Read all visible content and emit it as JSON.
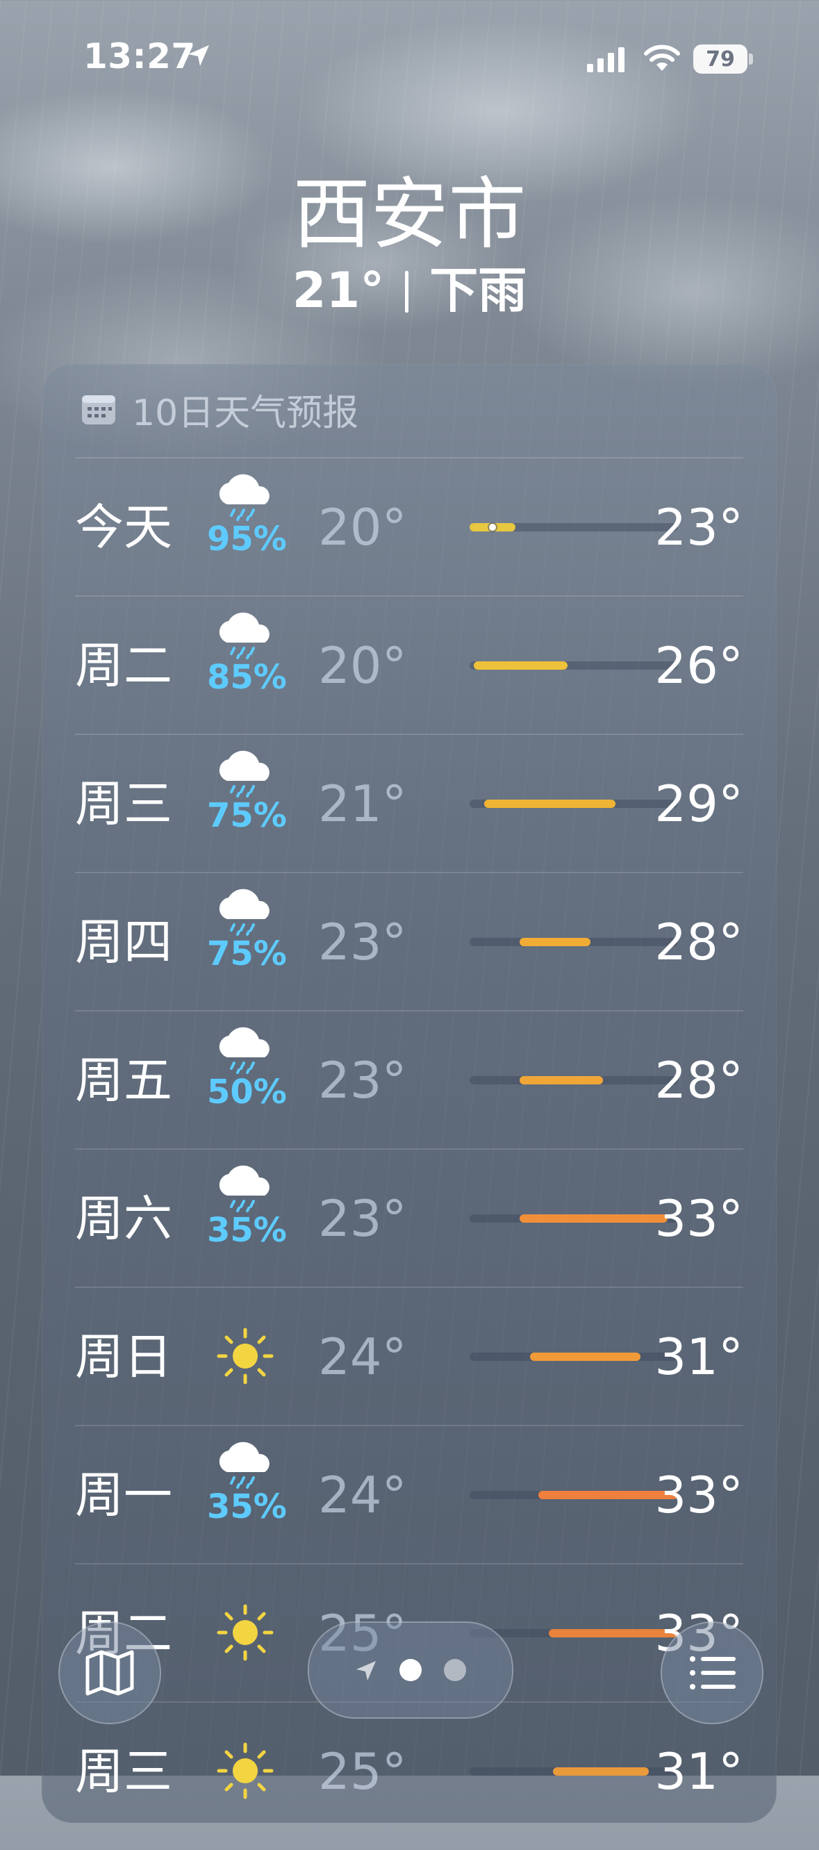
{
  "status_bar": {
    "time": "13:27",
    "battery": "79"
  },
  "header": {
    "city": "西安市",
    "temperature": "21°",
    "condition": "下雨"
  },
  "forecast": {
    "title": "10日天气预报",
    "days": [
      {
        "day": "今天",
        "icon": "cloud-rain-icon",
        "pop": "95%",
        "low": "20°",
        "high": "23°",
        "bar_start": 0,
        "bar_end": 0.22,
        "current_dot": 0.11,
        "bar_color": "#e8c840"
      },
      {
        "day": "周二",
        "icon": "cloud-rain-icon",
        "pop": "85%",
        "low": "20°",
        "high": "26°",
        "bar_start": 0.02,
        "bar_end": 0.47,
        "bar_color": "#eec13a"
      },
      {
        "day": "周三",
        "icon": "cloud-rain-icon",
        "pop": "75%",
        "low": "21°",
        "high": "29°",
        "bar_start": 0.07,
        "bar_end": 0.7,
        "bar_color": "#f0b434"
      },
      {
        "day": "周四",
        "icon": "cloud-rain-icon",
        "pop": "75%",
        "low": "23°",
        "high": "28°",
        "bar_start": 0.24,
        "bar_end": 0.58,
        "bar_color": "#f1ac36"
      },
      {
        "day": "周五",
        "icon": "cloud-rain-icon",
        "pop": "50%",
        "low": "23°",
        "high": "28°",
        "bar_start": 0.24,
        "bar_end": 0.64,
        "bar_color": "#f1a638"
      },
      {
        "day": "周六",
        "icon": "cloud-rain-icon",
        "pop": "35%",
        "low": "23°",
        "high": "33°",
        "bar_start": 0.24,
        "bar_end": 0.95,
        "bar_color": "#ef8f3a"
      },
      {
        "day": "周日",
        "icon": "sun-icon",
        "pop": "",
        "low": "24°",
        "high": "31°",
        "bar_start": 0.29,
        "bar_end": 0.82,
        "bar_color": "#f09a3a"
      },
      {
        "day": "周一",
        "icon": "cloud-rain-icon",
        "pop": "35%",
        "low": "24°",
        "high": "33°",
        "bar_start": 0.33,
        "bar_end": 1.0,
        "bar_color": "#ef7f3c"
      },
      {
        "day": "周二",
        "icon": "sun-icon",
        "pop": "",
        "low": "25°",
        "high": "33°",
        "bar_start": 0.38,
        "bar_end": 1.0,
        "bar_color": "#e9823a"
      },
      {
        "day": "周三",
        "icon": "sun-icon",
        "pop": "",
        "low": "25°",
        "high": "31°",
        "bar_start": 0.4,
        "bar_end": 0.86,
        "bar_color": "#e99a3a"
      }
    ]
  },
  "toolbar": {
    "map": "map-icon",
    "page_indicator": "location-arrow-icon",
    "list": "list-icon"
  }
}
